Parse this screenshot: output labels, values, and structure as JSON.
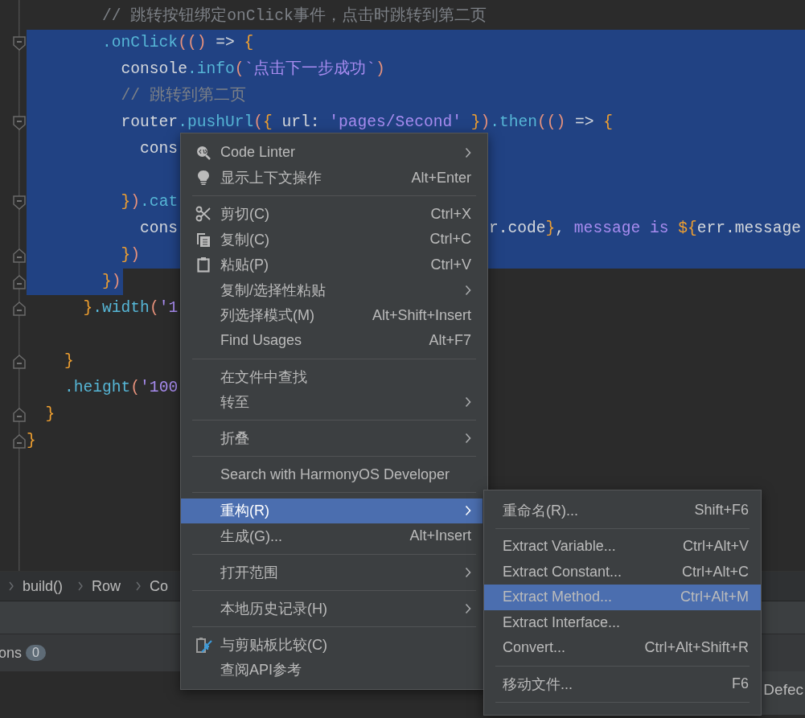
{
  "code_lines": [
    {
      "tokens": [
        {
          "text": "        // 跳转按钮绑定onClick事件，点击时跳转到第二页",
          "kind": "comment"
        }
      ],
      "selected": false
    },
    {
      "tokens": [
        {
          "text": "        .onClick",
          "kind": "method"
        },
        {
          "text": "(()",
          "kind": "paren"
        },
        {
          "text": " => ",
          "kind": "plain"
        },
        {
          "text": "{",
          "kind": "brace"
        }
      ],
      "selected": true
    },
    {
      "tokens": [
        {
          "text": "          console",
          "kind": "plain"
        },
        {
          "text": ".info",
          "kind": "method"
        },
        {
          "text": "(",
          "kind": "paren"
        },
        {
          "text": "`点击下一步成功`",
          "kind": "string"
        },
        {
          "text": ")",
          "kind": "paren"
        }
      ],
      "selected": true
    },
    {
      "tokens": [
        {
          "text": "          // 跳转到第二页",
          "kind": "comment"
        }
      ],
      "selected": true
    },
    {
      "tokens": [
        {
          "text": "          router",
          "kind": "plain"
        },
        {
          "text": ".pushUrl",
          "kind": "method"
        },
        {
          "text": "(",
          "kind": "paren"
        },
        {
          "text": "{",
          "kind": "brace"
        },
        {
          "text": " url: ",
          "kind": "plain"
        },
        {
          "text": "'pages/Second'",
          "kind": "string"
        },
        {
          "text": " }",
          "kind": "brace"
        },
        {
          "text": ")",
          "kind": "paren"
        },
        {
          "text": ".then",
          "kind": "method"
        },
        {
          "text": "(()",
          "kind": "paren"
        },
        {
          "text": " => ",
          "kind": "plain"
        },
        {
          "text": "{",
          "kind": "brace"
        }
      ],
      "selected": true
    },
    {
      "tokens": [
        {
          "text": "            cons",
          "kind": "plain"
        }
      ],
      "selected": true
    },
    {
      "selected": true
    },
    {
      "tokens": [
        {
          "text": "          }",
          "kind": "brace"
        },
        {
          "text": ")",
          "kind": "paren"
        },
        {
          "text": ".cat",
          "kind": "method"
        }
      ],
      "selected": true
    },
    {
      "tokens": [
        {
          "text": "            cons",
          "kind": "plain"
        }
      ],
      "tail": [
        {
          "text": "r.code",
          "kind": "plain"
        },
        {
          "text": "}",
          "kind": "brace"
        },
        {
          "text": ", ",
          "kind": "plain"
        },
        {
          "text": "message is ",
          "kind": "string"
        },
        {
          "text": "${",
          "kind": "brace"
        },
        {
          "text": "err.message",
          "kind": "plain"
        }
      ],
      "selected": true
    },
    {
      "tokens": [
        {
          "text": "          }",
          "kind": "brace"
        },
        {
          "text": ")",
          "kind": "paren"
        }
      ],
      "selected": true
    },
    {
      "tokens": [
        {
          "text": "        }",
          "kind": "brace"
        },
        {
          "text": ")",
          "kind": "paren"
        }
      ],
      "selected": true
    },
    {
      "tokens": [
        {
          "text": "      }",
          "kind": "brace"
        },
        {
          "text": ".width",
          "kind": "method"
        },
        {
          "text": "(",
          "kind": "paren"
        },
        {
          "text": "'1",
          "kind": "string"
        }
      ],
      "selected": false
    },
    {
      "selected": false
    },
    {
      "tokens": [
        {
          "text": "    }",
          "kind": "brace"
        }
      ],
      "selected": false
    },
    {
      "tokens": [
        {
          "text": "    .height",
          "kind": "method"
        },
        {
          "text": "(",
          "kind": "paren"
        },
        {
          "text": "'100",
          "kind": "string"
        }
      ],
      "selected": false
    },
    {
      "tokens": [
        {
          "text": "  }",
          "kind": "brace"
        }
      ],
      "selected": false
    },
    {
      "tokens": [
        {
          "text": "}",
          "kind": "brace"
        }
      ],
      "selected": false
    }
  ],
  "breadcrumb": [
    "build()",
    "Row",
    "Co"
  ],
  "problems_tab": {
    "label": "ons",
    "count": "0"
  },
  "side_tab": {
    "label": "Defec"
  },
  "context_menu": {
    "items": [
      {
        "kind": "item",
        "label": "Code Linter",
        "submenu": true,
        "selected": false
      },
      {
        "kind": "item",
        "label": "显示上下文操作",
        "shortcut": "Alt+Enter",
        "submenu": false,
        "selected": false
      },
      {
        "kind": "separator"
      },
      {
        "kind": "item",
        "label": "剪切(C)",
        "shortcut": "Ctrl+X",
        "submenu": false,
        "selected": false
      },
      {
        "kind": "item",
        "label": "复制(C)",
        "shortcut": "Ctrl+C",
        "submenu": false,
        "selected": false
      },
      {
        "kind": "item",
        "label": "粘贴(P)",
        "shortcut": "Ctrl+V",
        "submenu": false,
        "selected": false
      },
      {
        "kind": "item",
        "label": "复制/选择性粘贴",
        "submenu": true,
        "selected": false
      },
      {
        "kind": "item",
        "label": "列选择模式(M)",
        "shortcut": "Alt+Shift+Insert",
        "submenu": false,
        "selected": false
      },
      {
        "kind": "item",
        "label": "Find Usages",
        "shortcut": "Alt+F7",
        "submenu": false,
        "selected": false
      },
      {
        "kind": "separator"
      },
      {
        "kind": "item",
        "label": "在文件中查找",
        "submenu": false,
        "selected": false
      },
      {
        "kind": "item",
        "label": "转至",
        "submenu": true,
        "selected": false
      },
      {
        "kind": "separator"
      },
      {
        "kind": "item",
        "label": "折叠",
        "submenu": true,
        "selected": false
      },
      {
        "kind": "separator"
      },
      {
        "kind": "item",
        "label": "Search with HarmonyOS Developer",
        "submenu": false,
        "selected": false
      },
      {
        "kind": "separator"
      },
      {
        "kind": "item",
        "label": "重构(R)",
        "submenu": true,
        "selected": true
      },
      {
        "kind": "item",
        "label": "生成(G)...",
        "shortcut": "Alt+Insert",
        "submenu": false,
        "selected": false
      },
      {
        "kind": "separator"
      },
      {
        "kind": "item",
        "label": "打开范围",
        "submenu": true,
        "selected": false
      },
      {
        "kind": "separator"
      },
      {
        "kind": "item",
        "label": "本地历史记录(H)",
        "submenu": true,
        "selected": false
      },
      {
        "kind": "separator"
      },
      {
        "kind": "item",
        "label": "与剪贴板比较(C)",
        "submenu": false,
        "selected": false
      },
      {
        "kind": "item",
        "label": "查阅API参考",
        "submenu": false,
        "selected": false
      }
    ]
  },
  "submenu": {
    "items": [
      {
        "kind": "item",
        "label": "重命名(R)...",
        "shortcut": "Shift+F6",
        "selected": false
      },
      {
        "kind": "separator"
      },
      {
        "kind": "item",
        "label": "Extract Variable...",
        "shortcut": "Ctrl+Alt+V",
        "selected": false
      },
      {
        "kind": "item",
        "label": "Extract Constant...",
        "shortcut": "Ctrl+Alt+C",
        "selected": false
      },
      {
        "kind": "item",
        "label": "Extract Method...",
        "shortcut": "Ctrl+Alt+M",
        "selected": true
      },
      {
        "kind": "item",
        "label": "Extract Interface...",
        "selected": false
      },
      {
        "kind": "item",
        "label": "Convert...",
        "shortcut": "Ctrl+Alt+Shift+R",
        "selected": false
      },
      {
        "kind": "separator"
      },
      {
        "kind": "item",
        "label": "移动文件...",
        "shortcut": "F6",
        "selected": false
      },
      {
        "kind": "separator"
      }
    ]
  }
}
